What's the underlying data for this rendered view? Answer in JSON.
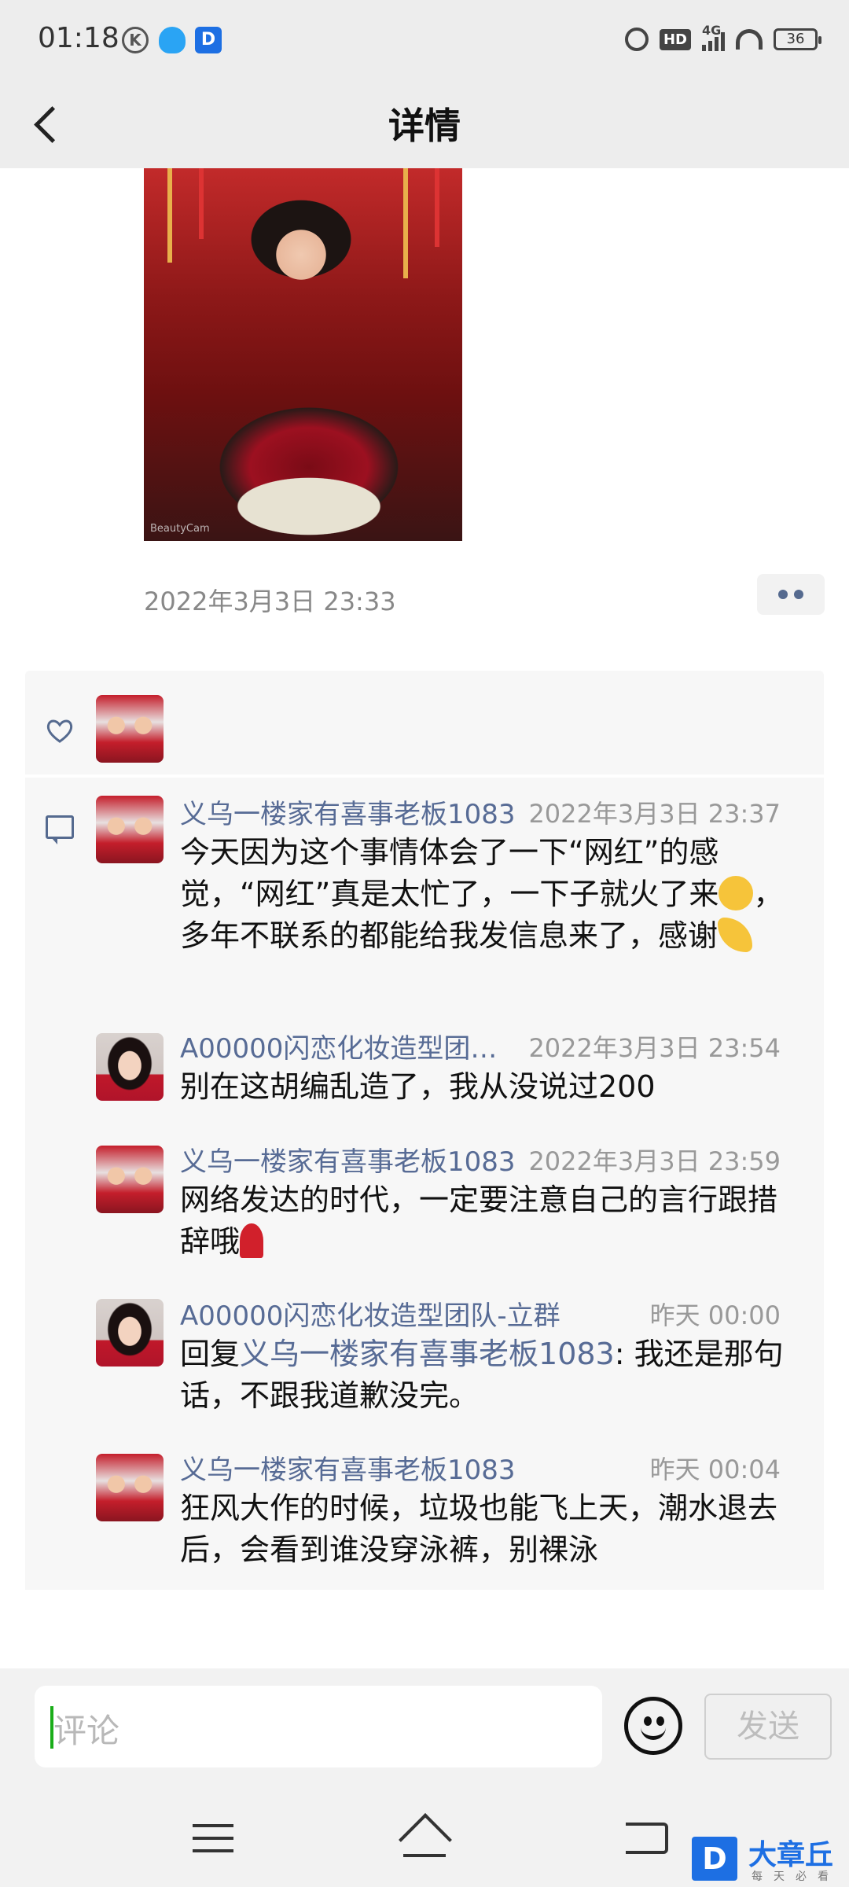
{
  "status_bar": {
    "time": "01:18",
    "network": "4G",
    "hd": "HD",
    "battery": "36"
  },
  "nav": {
    "title": "详情"
  },
  "post": {
    "photo_watermark": "BeautyCam",
    "timestamp": "2022年3月3日 23:33"
  },
  "comments": [
    {
      "name": "义乌一楼家有喜事老板1083",
      "time": "2022年3月3日 23:37",
      "text_part1": "今天因为这个事情体会了一下“网红”的感觉，“网红”真是太忙了，一下子就火了来",
      "text_part2": "，多年不联系的都能给我发信息来了，感谢"
    },
    {
      "name": "A00000闪恋化妆造型团…",
      "time": "2022年3月3日 23:54",
      "text": "别在这胡编乱造了，我从没说过200"
    },
    {
      "name": "义乌一楼家有喜事老板1083",
      "time": "2022年3月3日 23:59",
      "text": "网络发达的时代，一定要注意自己的言行跟措辞哦"
    },
    {
      "name": "A00000闪恋化妆造型团队-立群",
      "time": "昨天 00:00",
      "reply_prefix": "回复",
      "reply_to": "义乌一楼家有喜事老板1083",
      "text": ": 我还是那句话，不跟我道歉没完。"
    },
    {
      "name": "义乌一楼家有喜事老板1083",
      "time": "昨天 00:04",
      "text": "狂风大作的时候，垃圾也能飞上天，潮水退去后，会看到谁没穿泳裤，别裸泳"
    }
  ],
  "input": {
    "placeholder": "评论",
    "send_label": "发送"
  },
  "watermark": {
    "text": "大章丘",
    "sub": "每天必看",
    "badge": "D"
  }
}
